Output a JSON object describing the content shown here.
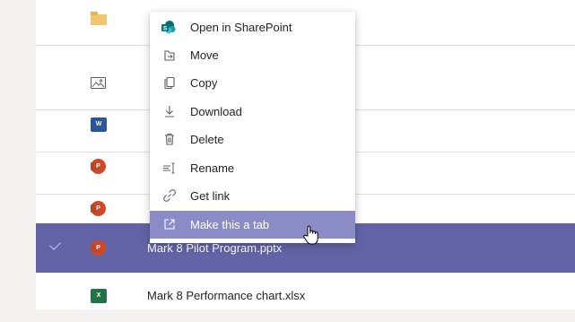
{
  "files": [
    {
      "name": "",
      "icon": "folder-icon",
      "type": "folder",
      "selected": false
    },
    {
      "name": "",
      "icon": "image-file-icon",
      "type": "image",
      "selected": false
    },
    {
      "name": "",
      "icon": "word-file-icon",
      "type": "word",
      "selected": false
    },
    {
      "name": "",
      "icon": "powerpoint-file-icon",
      "type": "ppt",
      "selected": false
    },
    {
      "name": "",
      "icon": "powerpoint-file-icon",
      "type": "ppt",
      "selected": false
    },
    {
      "name": "Mark 8 Pilot Program.pptx",
      "icon": "powerpoint-file-icon",
      "type": "ppt",
      "selected": true
    },
    {
      "name": "Mark 8 Performance chart.xlsx",
      "icon": "excel-file-icon",
      "type": "xlsx",
      "selected": false
    }
  ],
  "file_icon_letters": {
    "word": "W",
    "ppt": "P",
    "xlsx": "X"
  },
  "context_menu": {
    "items": [
      {
        "label": "Open in SharePoint",
        "icon": "sharepoint-icon"
      },
      {
        "label": "Move",
        "icon": "move-icon"
      },
      {
        "label": "Copy",
        "icon": "copy-icon"
      },
      {
        "label": "Download",
        "icon": "download-icon"
      },
      {
        "label": "Delete",
        "icon": "trash-icon"
      },
      {
        "label": "Rename",
        "icon": "rename-icon"
      },
      {
        "label": "Get link",
        "icon": "link-icon"
      },
      {
        "label": "Make this a tab",
        "icon": "open-in-new-icon",
        "hovered": true
      }
    ]
  },
  "colors": {
    "accent": "#6264a7",
    "menu_hover": "#8b8cc7",
    "word": "#2b579a",
    "excel": "#217346",
    "powerpoint": "#d24726",
    "folder": "#f2c66d",
    "sharepoint": "#038387"
  }
}
